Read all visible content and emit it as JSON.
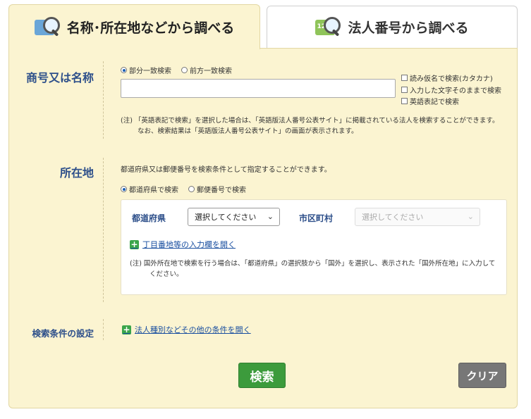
{
  "tabs": [
    {
      "label": "名称･所在地などから調べる",
      "icon": "search-name-icon",
      "active": true
    },
    {
      "label": "法人番号から調べる",
      "icon": "search-number-icon",
      "icon_text": "1234",
      "active": false
    }
  ],
  "name_section": {
    "label": "商号又は名称",
    "match_options": [
      "部分一致検索",
      "前方一致検索"
    ],
    "selected_match": "部分一致検索",
    "input_value": "",
    "checkboxes": [
      "読み仮名で検索(カタカナ)",
      "入力した文字そのままで検索",
      "英語表記で検索"
    ],
    "note_line1": "(注) 「英語表記で検索」を選択した場合は、「英語版法人番号公表サイト」に掲載されている法人を検索することができます。",
    "note_line2": "なお、検索結果は「英語版法人番号公表サイト」の画面が表示されます。"
  },
  "location_section": {
    "label": "所在地",
    "description": "都道府県又は郵便番号を検索条件として指定することができます。",
    "search_options": [
      "都道府県で検索",
      "郵便番号で検索"
    ],
    "selected_search": "都道府県で検索",
    "prefecture_label": "都道府県",
    "prefecture_value": "選択してください",
    "city_label": "市区町村",
    "city_value": "選択してください",
    "open_address_link": "丁目番地等の入力欄を開く",
    "note_line1": "(注) 国外所在地で検索を行う場合は、「都道府県」の選択肢から「国外」を選択し、表示された「国外所在地」に入力して",
    "note_line2": "ください。"
  },
  "conditions_section": {
    "label": "検索条件の設定",
    "open_link": "法人種別などその他の条件を開く"
  },
  "buttons": {
    "search": "検索",
    "clear": "クリア"
  },
  "colors": {
    "panel_bg": "#fbf4d1",
    "label_blue": "#2d4f8a",
    "search_green": "#3c9b3c",
    "clear_gray": "#777777"
  }
}
